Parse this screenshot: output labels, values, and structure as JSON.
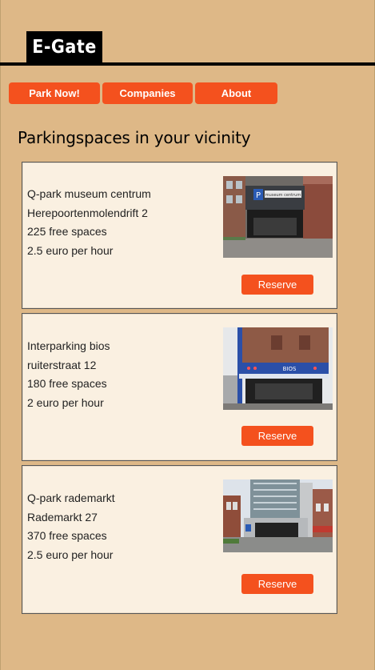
{
  "brand": {
    "logo_text": "E-Gate"
  },
  "nav": {
    "items": [
      {
        "label": "Park Now!"
      },
      {
        "label": "Companies"
      },
      {
        "label": "About"
      }
    ]
  },
  "main": {
    "heading": "Parkingspaces in your vicinity",
    "reserve_label": "Reserve",
    "garages": [
      {
        "name": "Q-park museum centrum",
        "address": "Herepoortenmolendrift 2",
        "free": "225 free spaces",
        "price": "2.5 euro per hour",
        "sign_text": "museum centrum"
      },
      {
        "name": "Interparking bios",
        "address": "ruiterstraat 12",
        "free": "180 free spaces",
        "price": "2 euro per hour",
        "sign_text": "BIOS"
      },
      {
        "name": "Q-park rademarkt",
        "address": "Rademarkt 27",
        "free": "370 free spaces",
        "price": "2.5 euro per hour",
        "sign_text": ""
      }
    ]
  },
  "colors": {
    "background": "#deb887",
    "accent": "#f4511e",
    "card": "#faf0e1",
    "logo_bg": "#000000"
  }
}
